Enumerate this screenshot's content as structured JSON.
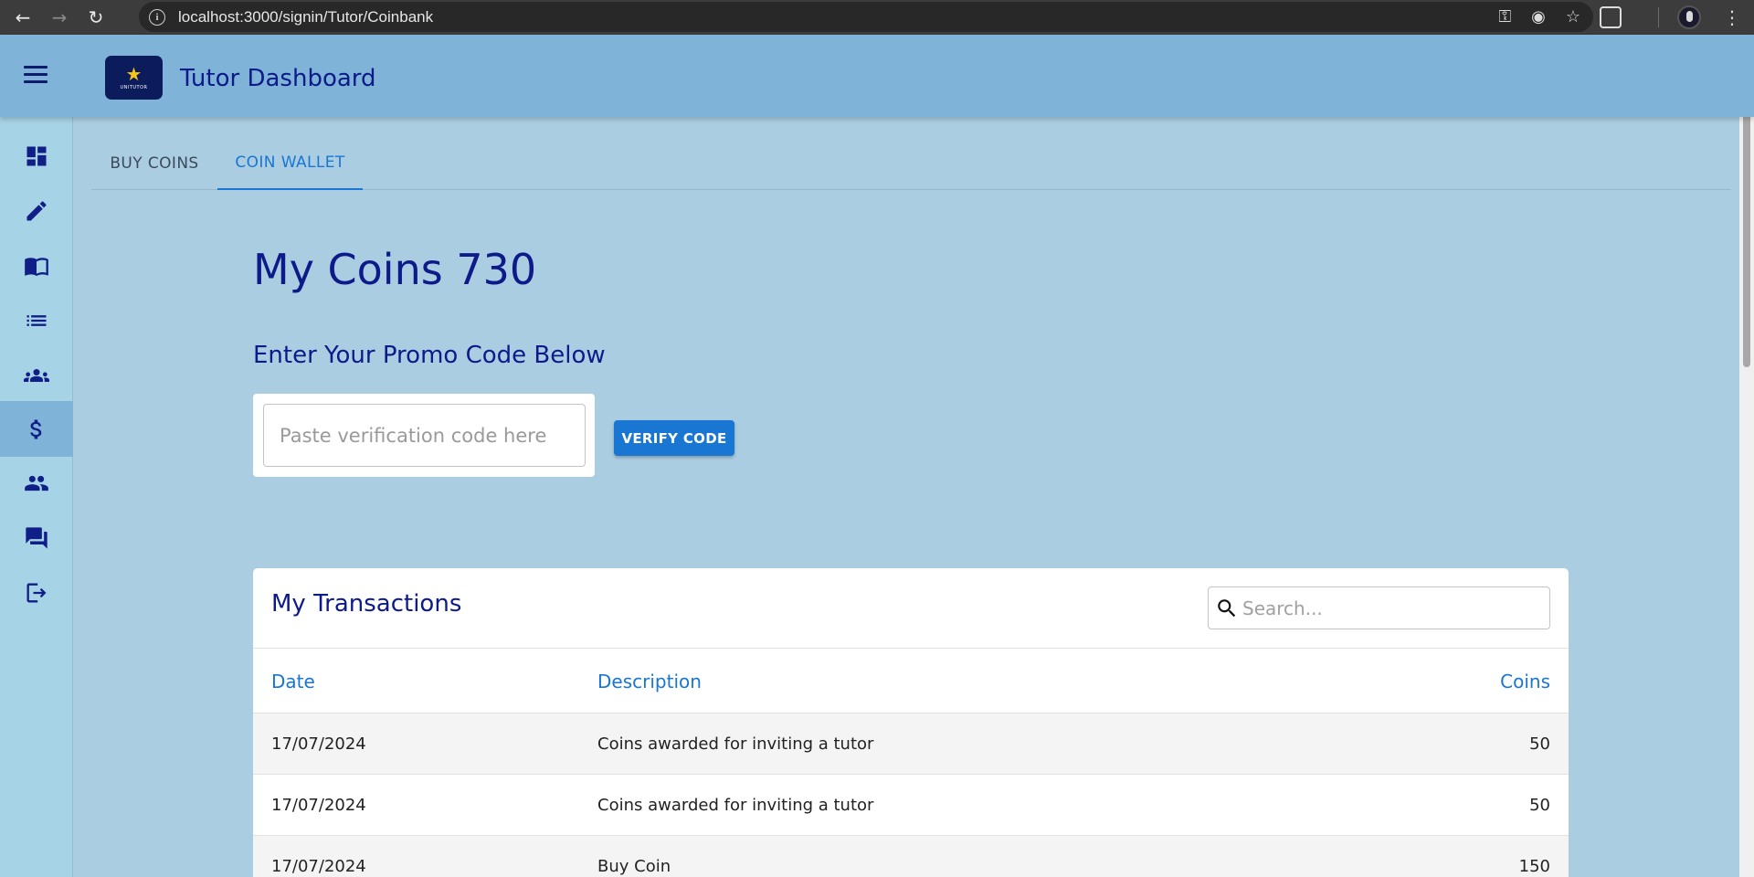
{
  "browser": {
    "url": "localhost:3000/signin/Tutor/Coinbank"
  },
  "app": {
    "title": "Tutor Dashboard",
    "logo_text": "UNITUTOR"
  },
  "sidebar": {
    "items": [
      {
        "name": "dashboard-icon",
        "active": false
      },
      {
        "name": "pencil-icon",
        "active": false
      },
      {
        "name": "book-icon",
        "active": false
      },
      {
        "name": "list-icon",
        "active": false
      },
      {
        "name": "groups-icon",
        "active": false
      },
      {
        "name": "dollar-icon",
        "active": true
      },
      {
        "name": "people-icon",
        "active": false
      },
      {
        "name": "forum-icon",
        "active": false
      },
      {
        "name": "logout-icon",
        "active": false
      }
    ]
  },
  "tabs": [
    {
      "label": "BUY COINS",
      "active": false
    },
    {
      "label": "COIN WALLET",
      "active": true
    }
  ],
  "wallet": {
    "coins_heading": "My Coins 730",
    "promo_heading": "Enter Your Promo Code Below",
    "promo_placeholder": "Paste verification code here",
    "verify_label": "VERIFY CODE"
  },
  "transactions": {
    "title": "My Transactions",
    "search_placeholder": "Search...",
    "columns": [
      "Date",
      "Description",
      "Coins"
    ],
    "rows": [
      {
        "date": "17/07/2024",
        "description": "Coins awarded for inviting a tutor",
        "coins": "50"
      },
      {
        "date": "17/07/2024",
        "description": "Coins awarded for inviting a tutor",
        "coins": "50"
      },
      {
        "date": "17/07/2024",
        "description": "Buy Coin",
        "coins": "150"
      }
    ]
  },
  "colors": {
    "primary": "#1976d2",
    "navy": "#0d1a8a",
    "appbar": "#7fb3d8",
    "page_bg": "#abcde2"
  }
}
